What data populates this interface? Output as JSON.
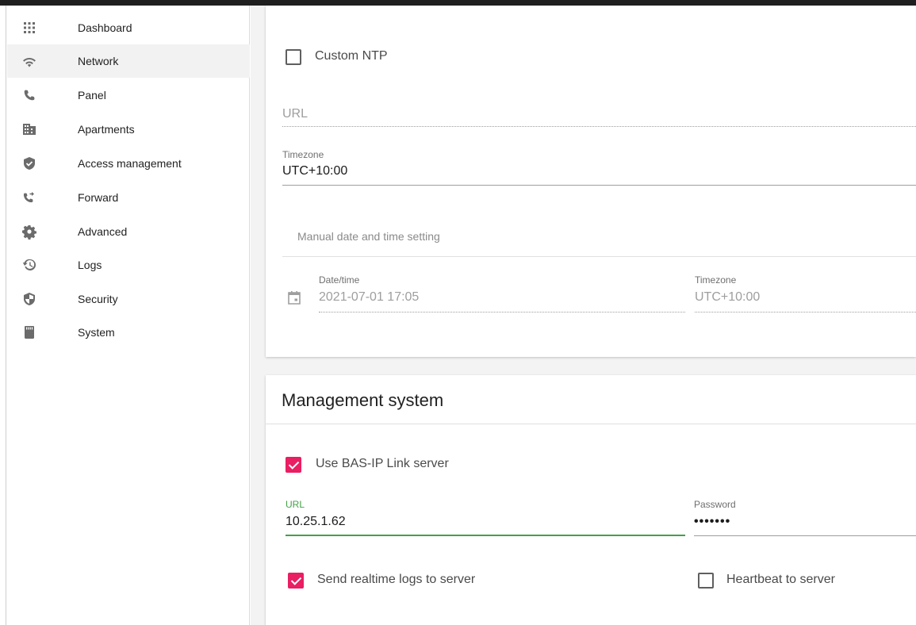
{
  "sidebar": {
    "items": [
      {
        "label": "Dashboard",
        "icon": "apps-grid-icon"
      },
      {
        "label": "Network",
        "icon": "wifi-icon",
        "active": true
      },
      {
        "label": "Panel",
        "icon": "phone-icon"
      },
      {
        "label": "Apartments",
        "icon": "building-icon"
      },
      {
        "label": "Access management",
        "icon": "shield-check-icon"
      },
      {
        "label": "Forward",
        "icon": "phone-forward-icon"
      },
      {
        "label": "Advanced",
        "icon": "gear-icon"
      },
      {
        "label": "Logs",
        "icon": "history-icon"
      },
      {
        "label": "Security",
        "icon": "shield-half-icon"
      },
      {
        "label": "System",
        "icon": "sd-card-icon"
      }
    ]
  },
  "time_settings": {
    "custom_ntp_label": "Custom NTP",
    "custom_ntp_checked": false,
    "url_placeholder": "URL",
    "timezone_label": "Timezone",
    "timezone_value": "UTC+10:00",
    "manual_label": "Manual date and time setting",
    "datetime_label": "Date/time",
    "datetime_value": "2021-07-01 17:05",
    "manual_timezone_label": "Timezone",
    "manual_timezone_value": "UTC+10:00"
  },
  "management_system": {
    "title": "Management system",
    "use_link_label": "Use BAS-IP Link server",
    "use_link_checked": true,
    "url_label": "URL",
    "url_value": "10.25.1.62",
    "password_label": "Password",
    "password_value": "•••••••",
    "realtime_logs_label": "Send realtime logs to server",
    "realtime_logs_checked": true,
    "heartbeat_label": "Heartbeat to server",
    "heartbeat_checked": false
  },
  "colors": {
    "accent": "#e91e63",
    "focus_green": "#43a047"
  }
}
